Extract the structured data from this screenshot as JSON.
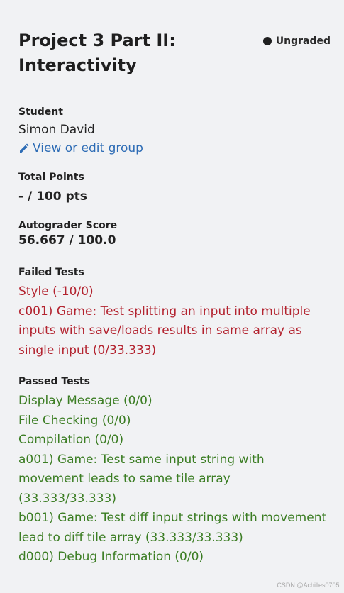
{
  "assignment": {
    "title": "Project 3 Part II: Interactivity",
    "status": "Ungraded"
  },
  "student": {
    "label": "Student",
    "name": "Simon David",
    "edit_link": "View or edit group"
  },
  "total_points": {
    "label": "Total Points",
    "value": "- / 100 pts"
  },
  "autograder": {
    "label": "Autograder Score",
    "value": "56.667 / 100.0"
  },
  "failed_tests": {
    "label": "Failed Tests",
    "items": [
      "Style (-10/0)",
      "c001) Game: Test splitting an input into multiple inputs with save/loads results in same array as single input (0/33.333)"
    ]
  },
  "passed_tests": {
    "label": "Passed Tests",
    "items": [
      "Display Message (0/0)",
      "File Checking (0/0)",
      "Compilation (0/0)",
      "a001) Game: Test same input string with movement leads to same tile array (33.333/33.333)",
      "b001) Game: Test diff input strings with movement lead to diff tile array (33.333/33.333)",
      "d000) Debug Information (0/0)"
    ]
  },
  "colors": {
    "failed": "#b3232f",
    "passed": "#3b7d23",
    "link": "#2d6cb5"
  },
  "icons": {
    "status": "status-dot-icon",
    "edit": "pencil-icon"
  },
  "watermark": "CSDN @Achilles0705."
}
